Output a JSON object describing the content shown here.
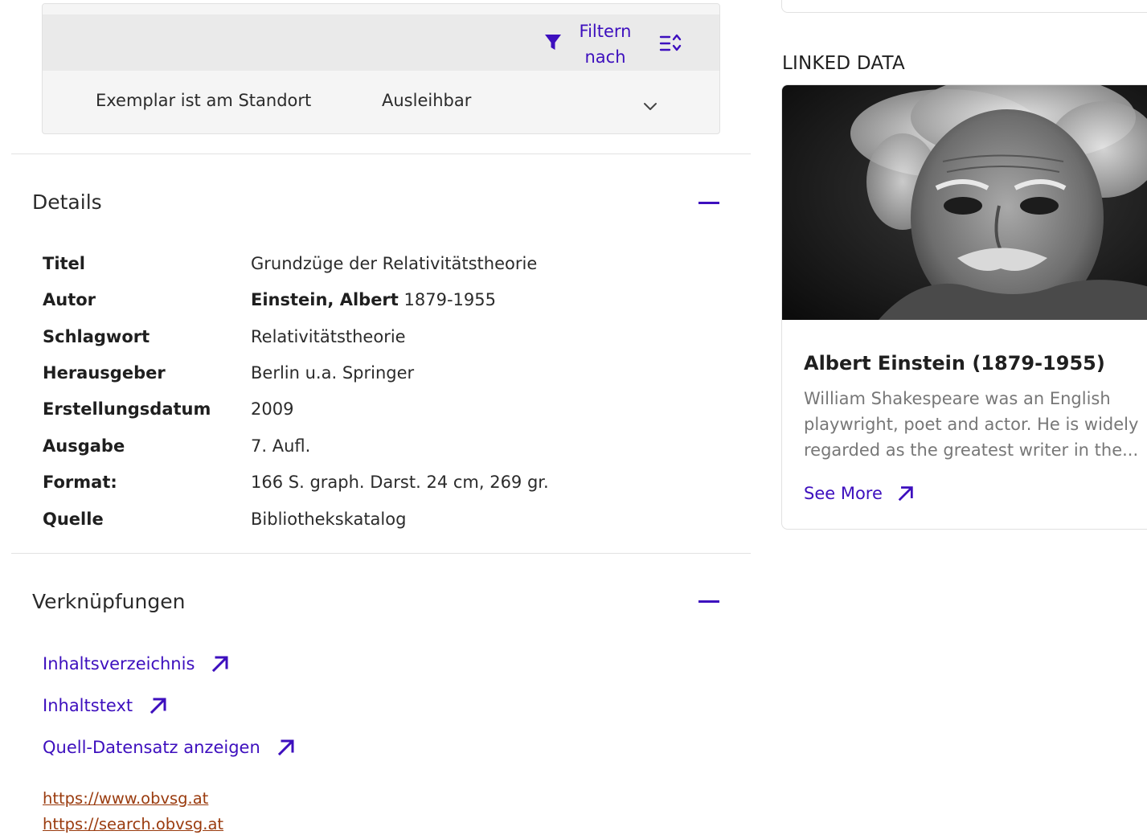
{
  "holdings": {
    "filter_label_line1": "Filtern",
    "filter_label_line2": "nach",
    "filter_icon": "filter-funnel-icon",
    "sort_icon": "sort-lines-icon",
    "row": {
      "location": "Exemplar ist am Standort",
      "status": "Ausleihbar",
      "expand_icon": "chevron-down-icon"
    }
  },
  "details": {
    "title": "Details",
    "collapse_icon": "minus-icon",
    "fields": [
      {
        "label": "Titel",
        "value": "Grundzüge der Relativitätstheorie"
      },
      {
        "label": "Autor",
        "value_bold": "Einstein, Albert",
        "value": " 1879-1955"
      },
      {
        "label": "Schlagwort",
        "value": "Relativitätstheorie"
      },
      {
        "label": "Herausgeber",
        "value": "Berlin u.a. Springer"
      },
      {
        "label": "Erstellungsdatum",
        "value": "2009"
      },
      {
        "label": "Ausgabe",
        "value": "7. Aufl."
      },
      {
        "label": "Format:",
        "value": "166 S. graph. Darst. 24 cm, 269 gr."
      },
      {
        "label": "Quelle",
        "value": "Bibliothekskatalog"
      }
    ]
  },
  "links": {
    "title": "Verknüpfungen",
    "collapse_icon": "minus-icon",
    "items": [
      {
        "label": "Inhaltsverzeichnis",
        "icon": "external-link-arrow-icon"
      },
      {
        "label": "Inhaltstext",
        "icon": "external-link-arrow-icon"
      },
      {
        "label": "Quell-Datensatz anzeigen",
        "icon": "external-link-arrow-icon"
      }
    ],
    "urls": [
      "https://www.obvsg.at",
      "https://search.obvsg.at"
    ]
  },
  "linked_data": {
    "heading": "LINKED DATA",
    "card": {
      "image": "albert-einstein-portrait",
      "name": "Albert Einstein (1879-1955)",
      "description": "William Shakespeare was an English playwright, poet and actor. He is widely regarded as the greatest writer in the...",
      "see_more": "See More",
      "see_more_icon": "external-link-arrow-icon"
    }
  },
  "colors": {
    "accent": "#3d0fbe",
    "url": "#9a3b0e",
    "muted_text": "#777777",
    "toolbar_bg": "#eaeaea",
    "row_bg": "#f5f5f5"
  }
}
